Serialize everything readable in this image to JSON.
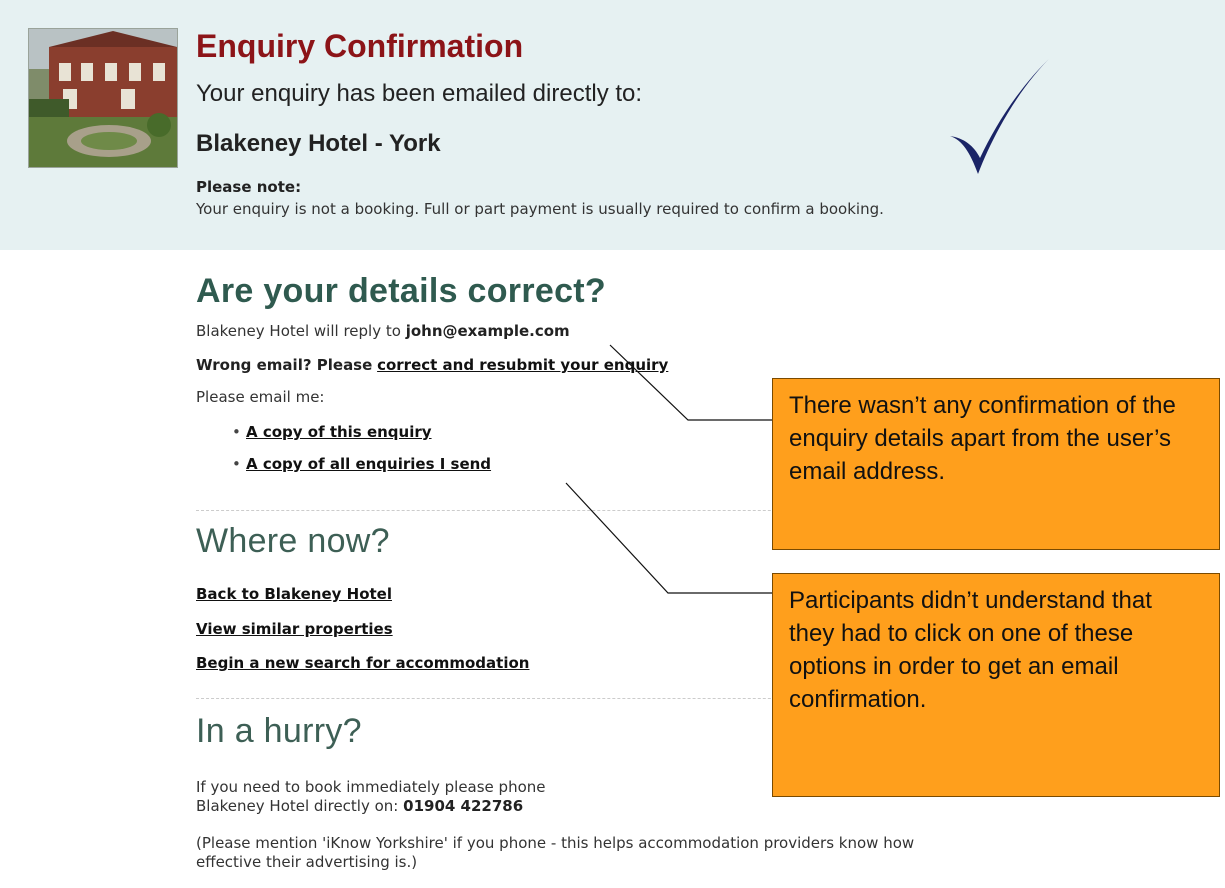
{
  "header": {
    "title": "Enquiry Confirmation",
    "subtitle": "Your enquiry has been emailed directly to:",
    "hotel_name": "Blakeney Hotel - York",
    "note_label": "Please note:",
    "note_text": "Your enquiry is not a booking. Full or part payment is usually required to confirm a booking.",
    "checkmark_icon": "checkmark-icon",
    "photo": "hotel-photo"
  },
  "details": {
    "heading": "Are your details correct?",
    "reply_prefix": "Blakeney Hotel will reply to",
    "email": "john@example.com",
    "wrong_prefix": "Wrong email? Please",
    "correct_link": "correct and resubmit your enquiry",
    "email_me": "Please email me:",
    "options": [
      "A copy of this enquiry",
      "A copy of all enquiries I send"
    ]
  },
  "where_now": {
    "heading": "Where now?",
    "links": [
      "Back to Blakeney Hotel",
      "View similar properties",
      "Begin a new search for accommodation"
    ]
  },
  "hurry": {
    "heading": "In a hurry?",
    "line1": "If you need to book immediately please phone",
    "line2_prefix": "Blakeney Hotel directly on:",
    "phone": "01904 422786",
    "mention": "(Please mention 'iKnow Yorkshire' if you phone - this helps accommodation providers know how",
    "mention2": "effective their advertising is.)"
  },
  "callouts": [
    {
      "text": "There wasn’t any confirmation of the enquiry details apart from the user’s email address."
    },
    {
      "text": "Participants didn’t understand that they had to click on one of these options in order to get an email confirmation."
    }
  ],
  "colors": {
    "banner_bg": "#e6f1f2",
    "title_red": "#8c1418",
    "heading_green": "#2f5a4f",
    "callout_orange": "#ff9f1c",
    "check_blue": "#1a2466"
  }
}
